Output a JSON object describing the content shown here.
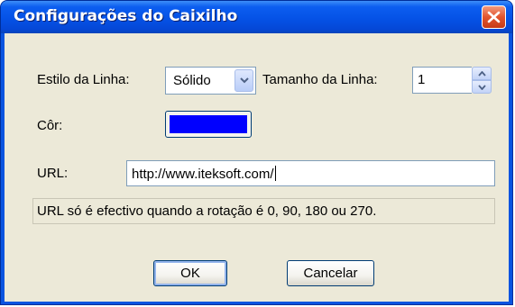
{
  "window": {
    "title": "Configurações do Caixilho"
  },
  "line_style": {
    "label": "Estilo da Linha:",
    "value": "Sólido"
  },
  "line_size": {
    "label": "Tamanho da Linha:",
    "value": "1"
  },
  "color": {
    "label": "Côr:",
    "value": "#0000ff"
  },
  "url": {
    "label": "URL:",
    "value": "http://www.iteksoft.com/"
  },
  "info": {
    "text": "URL só é efectivo quando a rotação é 0, 90, 180 ou 270."
  },
  "buttons": {
    "ok": "OK",
    "cancel": "Cancelar"
  },
  "icons": {
    "close": "close-icon",
    "dropdown": "chevron-down-icon",
    "spin_up": "up-arrow-icon",
    "spin_down": "down-arrow-icon"
  },
  "theme": {
    "titlebar": "#0552e6",
    "close_button": "#e2542e",
    "dialog_background": "#ece9d8"
  }
}
